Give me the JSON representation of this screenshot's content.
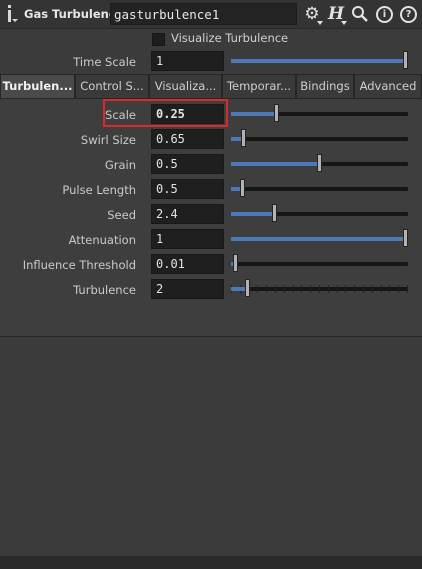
{
  "header": {
    "node_type": "Gas Turbulence",
    "node_name": "gasturbulence1",
    "icons": [
      "info-icon",
      "gear-icon",
      "houdini-help-icon",
      "search-icon",
      "info-circle-icon",
      "help-circle-icon"
    ],
    "h_glyph": "H",
    "info_glyph": "i",
    "help_glyph": "?"
  },
  "visualize": {
    "label": "Visualize Turbulence",
    "checked": false
  },
  "time_scale": {
    "label": "Time Scale",
    "value": "1",
    "fraction": 1.0
  },
  "tabs": [
    {
      "label": "Turbulen...",
      "active": true
    },
    {
      "label": "Control S...",
      "active": false
    },
    {
      "label": "Visualiza...",
      "active": false
    },
    {
      "label": "Temporar...",
      "active": false
    },
    {
      "label": "Bindings",
      "active": false
    },
    {
      "label": "Advanced",
      "active": false
    }
  ],
  "params": [
    {
      "label": "Scale",
      "value": "0.25",
      "fraction": 0.25,
      "highlighted": true
    },
    {
      "label": "Swirl Size",
      "value": "0.65",
      "fraction": 0.06
    },
    {
      "label": "Grain",
      "value": "0.5",
      "fraction": 0.5
    },
    {
      "label": "Pulse Length",
      "value": "0.5",
      "fraction": 0.05
    },
    {
      "label": "Seed",
      "value": "2.4",
      "fraction": 0.24
    },
    {
      "label": "Attenuation",
      "value": "1",
      "fraction": 1.0
    },
    {
      "label": "Influence Threshold",
      "value": "0.01",
      "fraction": 0.01
    },
    {
      "label": "Turbulence",
      "value": "2",
      "fraction": 0.08,
      "ticks": true
    }
  ],
  "colors": {
    "accent": "#4e78b7",
    "highlight": "#d92b2b",
    "background": "#3b3b3b",
    "field": "#1f1f1f"
  }
}
